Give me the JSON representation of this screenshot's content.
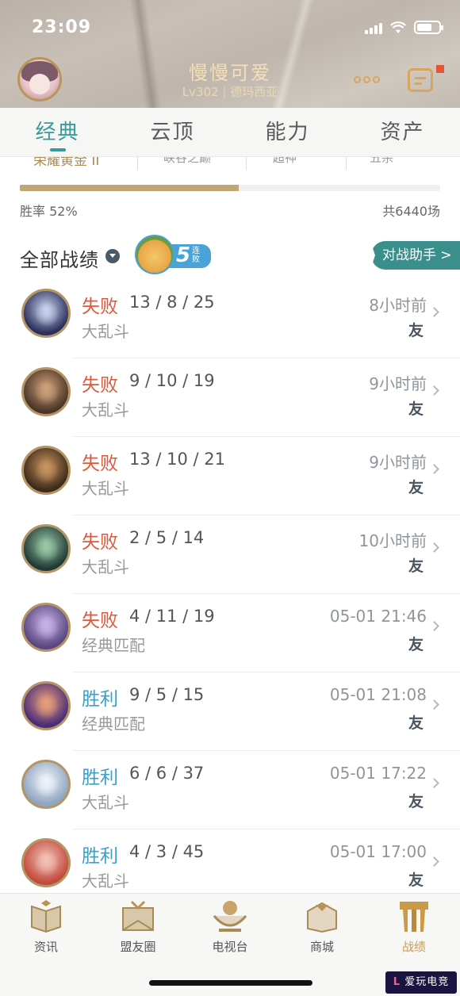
{
  "status_bar": {
    "time": "23:09"
  },
  "profile": {
    "name": "慢慢可爱",
    "level": "Lv302",
    "server": "德玛西亚",
    "separator": "|"
  },
  "tabs": [
    {
      "label": "经典",
      "active": true
    },
    {
      "label": "云顶",
      "active": false
    },
    {
      "label": "能力",
      "active": false
    },
    {
      "label": "资产",
      "active": false
    }
  ],
  "summary": {
    "partial_labels": [
      "荣耀黄金 II",
      "峡谷之巅",
      "超神",
      "五杀"
    ],
    "win_rate_label": "胜率 52%",
    "win_rate": 0.52,
    "total_label": "共6440场"
  },
  "records": {
    "title": "全部战绩",
    "streak": {
      "count": "5",
      "label": "连败"
    },
    "assistant_label": "对战助手 >"
  },
  "colors": {
    "accent": "#3a9a9a",
    "loss": "#e0573a",
    "win": "#3aa0c7",
    "gold": "#c99a49"
  },
  "matches": [
    {
      "result": "失败",
      "outcome": "loss",
      "kda": "13 / 8 / 25",
      "mode": "大乱斗",
      "time": "8小时前",
      "tag": "友",
      "champ_color": "#2b2f5a",
      "glow": "#c7d4f0"
    },
    {
      "result": "失败",
      "outcome": "loss",
      "kda": "9 / 10 / 19",
      "mode": "大乱斗",
      "time": "9小时前",
      "tag": "友",
      "champ_color": "#4a3526",
      "glow": "#d0a27a"
    },
    {
      "result": "失败",
      "outcome": "loss",
      "kda": "13 / 10 / 21",
      "mode": "大乱斗",
      "time": "9小时前",
      "tag": "友",
      "champ_color": "#3d2a1a",
      "glow": "#c9955e"
    },
    {
      "result": "失败",
      "outcome": "loss",
      "kda": "2 / 5 / 14",
      "mode": "大乱斗",
      "time": "10小时前",
      "tag": "友",
      "champ_color": "#1f3a35",
      "glow": "#9cc9a8"
    },
    {
      "result": "失败",
      "outcome": "loss",
      "kda": "4 / 11 / 19",
      "mode": "经典匹配",
      "time": "05-01 21:46",
      "tag": "友",
      "champ_color": "#5a4680",
      "glow": "#c8b4e8"
    },
    {
      "result": "胜利",
      "outcome": "win",
      "kda": "9 / 5 / 15",
      "mode": "经典匹配",
      "time": "05-01 21:08",
      "tag": "友",
      "champ_color": "#4a2d78",
      "glow": "#e9a07a"
    },
    {
      "result": "胜利",
      "outcome": "win",
      "kda": "6 / 6 / 37",
      "mode": "大乱斗",
      "time": "05-01 17:22",
      "tag": "友",
      "champ_color": "#8fa6c0",
      "glow": "#f0f4fa"
    },
    {
      "result": "胜利",
      "outcome": "win",
      "kda": "4 / 3 / 45",
      "mode": "大乱斗",
      "time": "05-01 17:00",
      "tag": "友",
      "champ_color": "#c24a3c",
      "glow": "#f3c3b8"
    }
  ],
  "bottom_nav": [
    {
      "label": "资讯",
      "icon": "news-icon",
      "active": false
    },
    {
      "label": "盟友圈",
      "icon": "friends-circle-icon",
      "active": false
    },
    {
      "label": "电视台",
      "icon": "tv-icon",
      "active": false
    },
    {
      "label": "商城",
      "icon": "shop-icon",
      "active": false
    },
    {
      "label": "战绩",
      "icon": "records-icon",
      "active": true
    }
  ],
  "watermark": {
    "brand": "爱玩电竞"
  }
}
